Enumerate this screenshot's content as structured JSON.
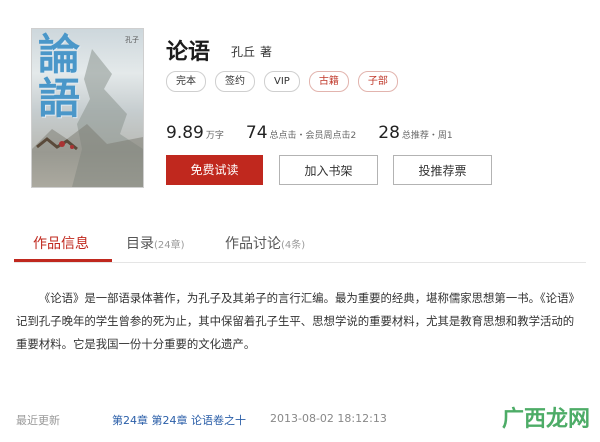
{
  "book": {
    "cover_title": "論語",
    "cover_subtitle": "孔子",
    "title": "论语",
    "author": "孔丘",
    "author_role": "著"
  },
  "tags": [
    "完本",
    "签约",
    "VIP",
    "古籍",
    "子部"
  ],
  "stats": {
    "words": "9.89",
    "words_unit": "万字",
    "clicks": "74",
    "clicks_unit": "总点击・会员周点击2",
    "recommend": "28",
    "recommend_unit": "总推荐・周1"
  },
  "buttons": {
    "read": "免费试读",
    "shelf": "加入书架",
    "recommend": "投推荐票"
  },
  "tabs": [
    {
      "label": "作品信息",
      "count": ""
    },
    {
      "label": "目录",
      "count": "(24章)"
    },
    {
      "label": "作品讨论",
      "count": "(4条)"
    }
  ],
  "description": "《论语》是一部语录体著作，为孔子及其弟子的言行汇编。最为重要的经典，堪称儒家思想第一书。《论语》记到孔子晚年的学生曾参的死为止，其中保留着孔子生平、思想学说的重要材料，尤其是教育思想和教学活动的重要材料。它是我国一份十分重要的文化遗产。",
  "latest": {
    "label": "最近更新",
    "chapter": "第24章 第24章 论语卷之十",
    "time": "2013-08-02 18:12:13"
  },
  "watermark": "广西龙网",
  "colors": {
    "accent": "#c0281e",
    "link": "#2a5ea8",
    "watermark": "#2e9e4d"
  }
}
